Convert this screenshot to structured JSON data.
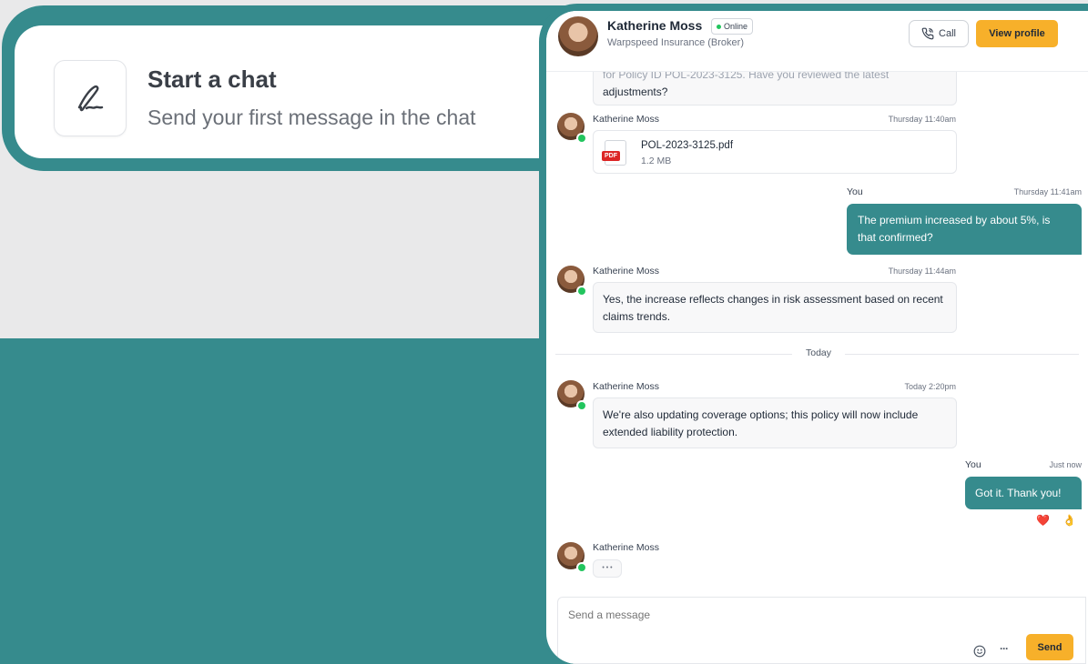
{
  "start_chat": {
    "title": "Start a chat",
    "subtitle": "Send your first message in the chat"
  },
  "header": {
    "name": "Katherine Moss",
    "status": "Online",
    "company": "Warpspeed Insurance (Broker)",
    "call_label": "Call",
    "view_profile_label": "View profile"
  },
  "messages": {
    "partial_text_line1": "for Policy ID POL-2023-3125. Have you reviewed the latest",
    "partial_text_line2": "adjustments?",
    "m1": {
      "sender": "Katherine Moss",
      "time": "Thursday 11:40am",
      "file_name": "POL-2023-3125.pdf",
      "file_size": "1.2 MB",
      "file_badge": "PDF"
    },
    "m2": {
      "sender": "You",
      "time": "Thursday 11:41am",
      "text": "The premium increased by about 5%, is that confirmed?"
    },
    "m3": {
      "sender": "Katherine Moss",
      "time": "Thursday 11:44am",
      "text": "Yes, the increase reflects changes in risk assessment based on recent claims trends."
    },
    "divider": "Today",
    "m4": {
      "sender": "Katherine Moss",
      "time": "Today 2:20pm",
      "text": "We're also updating coverage options; this policy will now include extended liability protection."
    },
    "m5": {
      "sender": "You",
      "time": "Just now",
      "text": "Got it. Thank you!",
      "reactions": [
        "❤️",
        "👌"
      ]
    },
    "m6": {
      "sender": "Katherine Moss",
      "typing": "• • •"
    }
  },
  "composer": {
    "placeholder": "Send a message",
    "send_label": "Send"
  },
  "colors": {
    "teal": "#368b8d",
    "accent": "#f7b02a",
    "online": "#22c55e"
  }
}
